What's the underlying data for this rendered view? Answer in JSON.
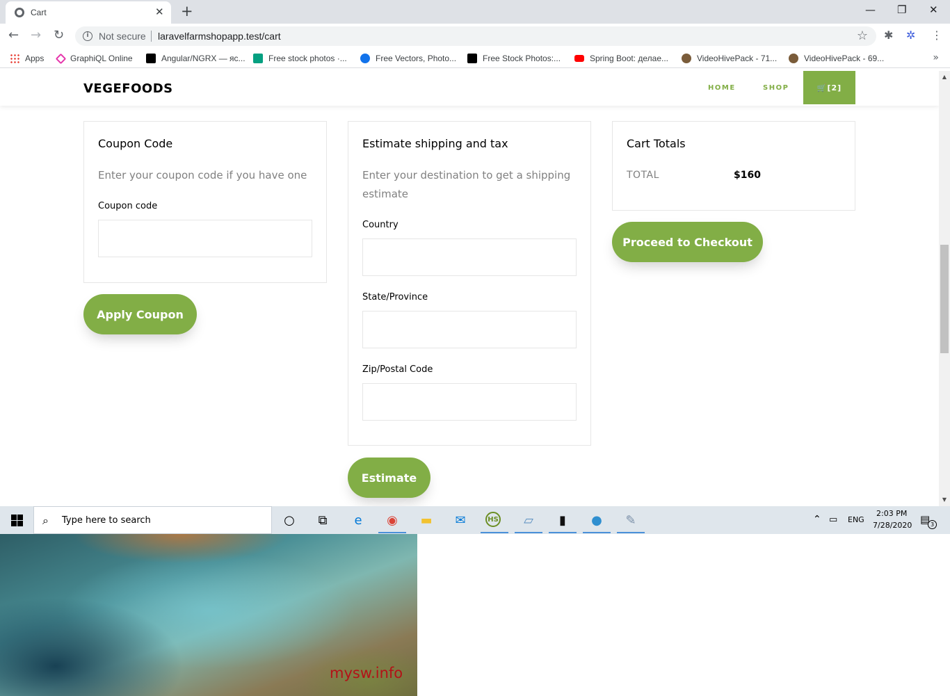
{
  "browser": {
    "tab_title": "Cart",
    "tab_close": "✕",
    "new_tab": "+",
    "window_controls": {
      "minimize": "—",
      "restore": "❐",
      "close": "✕"
    },
    "nav": {
      "back": "←",
      "forward": "→",
      "reload": "↻"
    },
    "security_icon": "i",
    "security_label": "Not secure",
    "url": "laravelfarmshopapp.test/cart",
    "star": "☆",
    "extensions_icon": "✱",
    "profile_icon": "✲",
    "menu_icon": "⋮",
    "bookmarks": [
      {
        "label": "Apps",
        "icon": "apps-icon",
        "color": "#e8453c"
      },
      {
        "label": "GraphiQL Online",
        "icon": "graphiql-icon",
        "color": "#e535ab"
      },
      {
        "label": "Angular/NGRX — яс...",
        "icon": "medium-icon",
        "color": "#000000"
      },
      {
        "label": "Free stock photos ·...",
        "icon": "pexels-icon",
        "color": "#05a081"
      },
      {
        "label": "Free Vectors, Photo...",
        "icon": "freepik-icon",
        "color": "#1273eb"
      },
      {
        "label": "Free Stock Photos:...",
        "icon": "burst-icon",
        "color": "#000000"
      },
      {
        "label": "Spring Boot: делае...",
        "icon": "youtube-icon",
        "color": "#ff0000"
      },
      {
        "label": "VideoHivePack - 71...",
        "icon": "videohive-icon",
        "color": "#7a5c3a"
      },
      {
        "label": "VideoHivePack - 69...",
        "icon": "videohive-icon",
        "color": "#7a5c3a"
      }
    ],
    "bookmarks_more": "»"
  },
  "site": {
    "brand": "VEGEFOODS",
    "nav": {
      "home": "HOME",
      "shop": "SHOP",
      "cart": "🛒[2]"
    },
    "accent_color": "#82ae46"
  },
  "coupon": {
    "title": "Coupon Code",
    "description": "Enter your coupon code if you have one",
    "field_label": "Coupon code",
    "field_value": "",
    "button": "Apply Coupon"
  },
  "shipping": {
    "title": "Estimate shipping and tax",
    "description": "Enter your destination to get a shipping estimate",
    "country_label": "Country",
    "country_value": "",
    "state_label": "State/Province",
    "state_value": "",
    "zip_label": "Zip/Postal Code",
    "zip_value": "",
    "button": "Estimate"
  },
  "totals": {
    "title": "Cart Totals",
    "total_label": "TOTAL",
    "total_value": "$160",
    "button": "Proceed to Checkout"
  },
  "taskbar": {
    "search_placeholder": "Type here to search",
    "search_icon": "⌕",
    "cortana_icon": "○",
    "taskview_icon": "⧉",
    "language": "ENG",
    "time": "2:03 PM",
    "date": "7/28/2020",
    "notification_count": "3",
    "tray_chevron": "⌃",
    "apps": [
      {
        "name": "edge-icon",
        "glyph": "e",
        "color": "#0078d7",
        "active": false
      },
      {
        "name": "chrome-icon",
        "glyph": "◉",
        "color": "#db4437",
        "active": true
      },
      {
        "name": "file-explorer-icon",
        "glyph": "▬",
        "color": "#f2c230",
        "active": false
      },
      {
        "name": "mail-icon",
        "glyph": "✉",
        "color": "#0078d7",
        "active": false
      },
      {
        "name": "heidisql-icon",
        "glyph": "HS",
        "color": "#6b8e23",
        "active": true
      },
      {
        "name": "notepad-icon",
        "glyph": "▱",
        "color": "#5a8fc0",
        "active": true
      },
      {
        "name": "terminal-icon",
        "glyph": "▮",
        "color": "#111111",
        "active": true
      },
      {
        "name": "postgres-icon",
        "glyph": "●",
        "color": "#2f8fd0",
        "active": true
      },
      {
        "name": "paint-icon",
        "glyph": "✎",
        "color": "#7a8fa8",
        "active": true
      }
    ]
  },
  "desktop": {
    "watermark": "mysw.info"
  }
}
